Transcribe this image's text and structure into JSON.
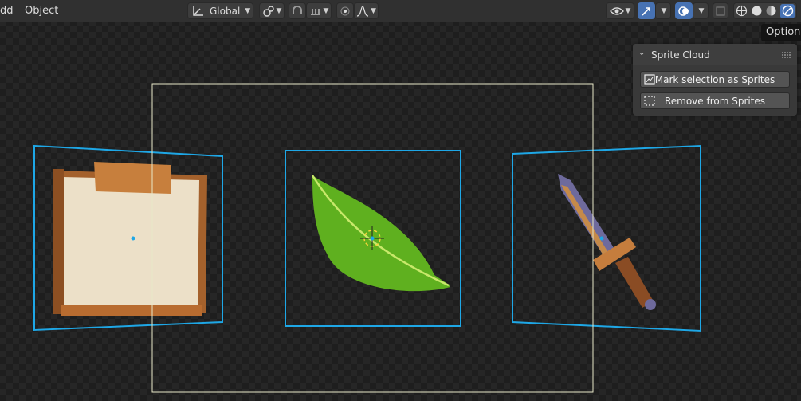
{
  "header": {
    "menu": {
      "add": "dd",
      "object": "Object"
    },
    "transform_orientation": "Global"
  },
  "tooltip": {
    "text": "Options"
  },
  "sprite_panel": {
    "title": "Sprite Cloud",
    "mark_button": "Mark selection as Sprites",
    "remove_button": "Remove from Sprites"
  },
  "colors": {
    "accent": "#4772b3",
    "selection_outline": "#1ea7e6",
    "camera_frame": "#e8e8c8"
  }
}
